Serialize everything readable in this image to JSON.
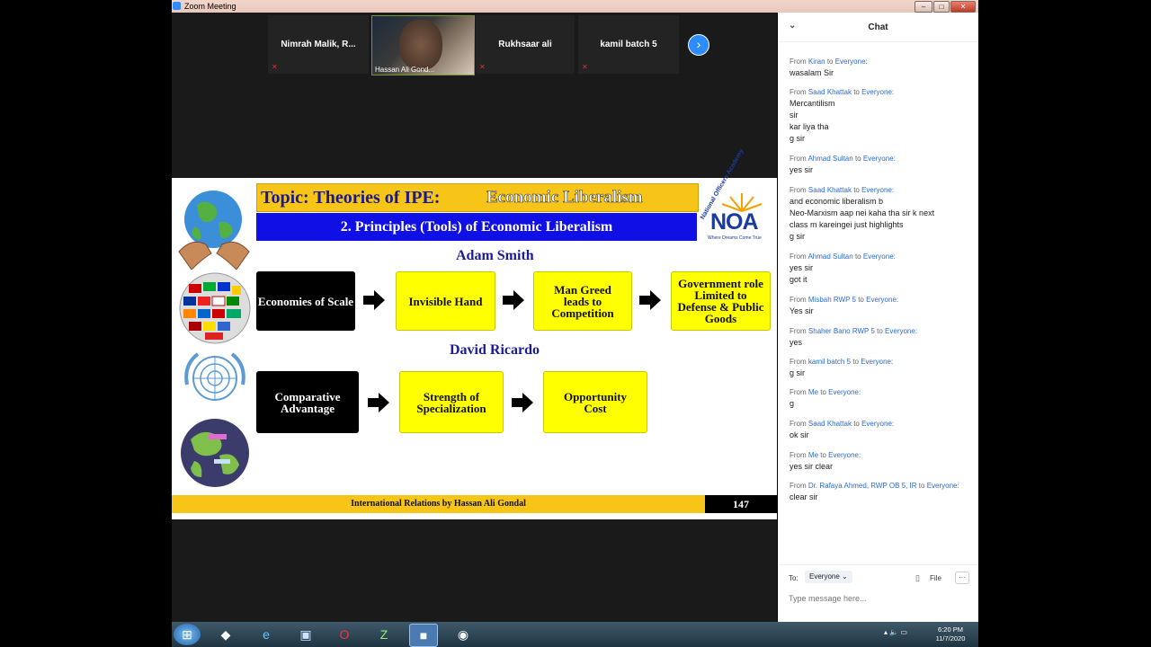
{
  "window": {
    "title": "Zoom Meeting"
  },
  "participants": [
    {
      "name": "Nimrah Malik, R..."
    },
    {
      "name": "Hassan Ali Gond..."
    },
    {
      "name": "Rukhsaar ali"
    },
    {
      "name": "kamil batch 5"
    }
  ],
  "slide": {
    "topic_prefix": "Topic: Theories of IPE:",
    "topic_suffix": "Economic Liberalism",
    "heading": "2. Principles (Tools) of Economic Liberalism",
    "noa_logo": "NOA",
    "noa_arc": "National Officers Academy",
    "noa_tagline": "Where Dreams Come True",
    "adam_smith": {
      "title": "Adam Smith",
      "boxes": [
        "Economies of Scale",
        "Invisible Hand",
        "Man Greed leads to Competition",
        "Government role Limited to Defense & Public Goods"
      ]
    },
    "david_ricardo": {
      "title": "David Ricardo",
      "boxes": [
        "Comparative Advantage",
        "Strength of Specialization",
        "Opportunity Cost"
      ]
    },
    "footer": "International Relations by Hassan Ali Gondal",
    "page_number": "147"
  },
  "chat": {
    "title": "Chat",
    "messages": [
      {
        "from_label": "From",
        "sender": "Kiran",
        "to_label": "to",
        "recipient": "Everyone:",
        "lines": [
          "wasalam Sir"
        ]
      },
      {
        "from_label": "From",
        "sender": "Saad Khattak",
        "to_label": "to",
        "recipient": "Everyone:",
        "lines": [
          "Mercantilism",
          "sir",
          "kar liya tha",
          "g sir"
        ]
      },
      {
        "from_label": "From",
        "sender": "Ahmad Sultan",
        "to_label": "to",
        "recipient": "Everyone:",
        "lines": [
          "yes sir"
        ]
      },
      {
        "from_label": "From",
        "sender": "Saad Khattak",
        "to_label": "to",
        "recipient": "Everyone:",
        "lines": [
          "and economic liberalism b",
          "Neo-Marxism aap nei kaha tha sir k next",
          "class m kareingei just highlights",
          "g sir"
        ]
      },
      {
        "from_label": "From",
        "sender": "Ahmad Sultan",
        "to_label": "to",
        "recipient": "Everyone:",
        "lines": [
          "yes sir",
          "got it"
        ]
      },
      {
        "from_label": "From",
        "sender": "Misbah RWP 5",
        "to_label": "to",
        "recipient": "Everyone:",
        "lines": [
          "Yes sir"
        ]
      },
      {
        "from_label": "From",
        "sender": "Shaher Bano RWP 5",
        "to_label": "to",
        "recipient": "Everyone:",
        "lines": [
          "yes"
        ]
      },
      {
        "from_label": "From",
        "sender": "kamil batch 5",
        "to_label": "to",
        "recipient": "Everyone:",
        "lines": [
          "g sir"
        ]
      },
      {
        "from_label": "From",
        "sender": "Me",
        "to_label": "to",
        "recipient": "Everyone:",
        "lines": [
          "g"
        ]
      },
      {
        "from_label": "From",
        "sender": "Saad Khattak",
        "to_label": "to",
        "recipient": "Everyone:",
        "lines": [
          "ok sir"
        ]
      },
      {
        "from_label": "From",
        "sender": "Me",
        "to_label": "to",
        "recipient": "Everyone:",
        "lines": [
          "yes sir clear"
        ]
      },
      {
        "from_label": "From",
        "sender": "Dr. Rafaya Ahmed, RWP OB 5, IR",
        "to_label": "to",
        "recipient": "Everyone:",
        "lines": [
          "clear sir"
        ]
      }
    ],
    "to_label": "To:",
    "recipient_select": "Everyone",
    "file_label": "File",
    "more_label": "···",
    "input_placeholder": "Type message here..."
  },
  "taskbar": {
    "time": "6:20 PM",
    "date": "11/7/2020"
  }
}
